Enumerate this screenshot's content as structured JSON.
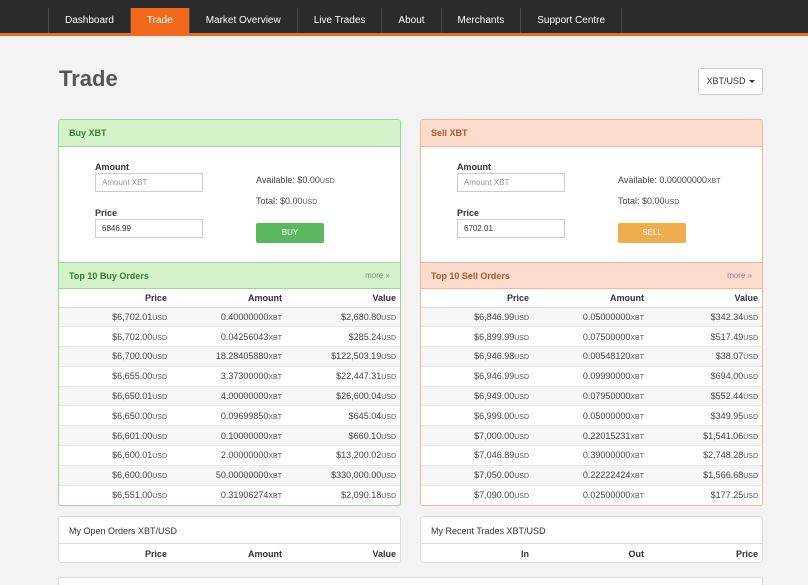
{
  "nav": {
    "items": [
      {
        "label": "Dashboard"
      },
      {
        "label": "Trade"
      },
      {
        "label": "Market Overview"
      },
      {
        "label": "Live Trades"
      },
      {
        "label": "About"
      },
      {
        "label": "Merchants"
      },
      {
        "label": "Support Centre"
      }
    ],
    "active_color": "#f26b1d"
  },
  "page": {
    "title": "Trade",
    "pair": "XBT/USD"
  },
  "buy": {
    "header": "Buy XBT",
    "amount_label": "Amount",
    "amount_placeholder": "Amount XBT",
    "price_label": "Price",
    "price_value": "6846.99",
    "available_label": "Available:",
    "available_value": "$0.00",
    "available_unit": "USD",
    "total_label": "Total:",
    "total_value": "$0.00",
    "total_unit": "USD",
    "button": "BUY",
    "button_color": "#5cb85c"
  },
  "sell": {
    "header": "Sell XBT",
    "amount_label": "Amount",
    "amount_placeholder": "Amount XBT",
    "price_label": "Price",
    "price_value": "6702.01",
    "available_label": "Available:",
    "available_value": "0.00000000",
    "available_unit": "XBT",
    "total_label": "Total:",
    "total_value": "$0.00",
    "total_unit": "USD",
    "button": "SELL",
    "button_color": "#f0ad4e"
  },
  "buy_orders": {
    "title": "Top 10 Buy Orders",
    "more": "more »",
    "columns": [
      "Price",
      "Amount",
      "Value"
    ],
    "rows": [
      [
        "$6,702.01",
        "0.40000000",
        "$2,680.80"
      ],
      [
        "$6,702.00",
        "0.04256043",
        "$285.24"
      ],
      [
        "$6,700.00",
        "18.28405880",
        "$122,503.19"
      ],
      [
        "$6,655.00",
        "3.37300000",
        "$22,447.31"
      ],
      [
        "$6,650.01",
        "4.00000000",
        "$26,600.04"
      ],
      [
        "$6,650.00",
        "0.09699850",
        "$645.04"
      ],
      [
        "$6,601.00",
        "0.10000000",
        "$660.10"
      ],
      [
        "$6,600.01",
        "2.00000000",
        "$13,200.02"
      ],
      [
        "$6,600.00",
        "50.00000000",
        "$330,000.00"
      ],
      [
        "$6,551.00",
        "0.31906274",
        "$2,090.18"
      ]
    ]
  },
  "sell_orders": {
    "title": "Top 10 Sell Orders",
    "more": "more »",
    "columns": [
      "Price",
      "Amount",
      "Value"
    ],
    "rows": [
      [
        "$6,846.99",
        "0.05000000",
        "$342.34"
      ],
      [
        "$6,899.99",
        "0.07500000",
        "$517.49"
      ],
      [
        "$6,946.98",
        "0.00548120",
        "$38.07"
      ],
      [
        "$6,946.99",
        "0.09990000",
        "$694.00"
      ],
      [
        "$6,949.00",
        "0.07950000",
        "$552.44"
      ],
      [
        "$6,999.00",
        "0.05000000",
        "$349.95"
      ],
      [
        "$7,000.00",
        "0.22015231",
        "$1,541.06"
      ],
      [
        "$7,046.89",
        "0.39000000",
        "$2,748.28"
      ],
      [
        "$7,050.00",
        "0.22222424",
        "$1,566.68"
      ],
      [
        "$7,090.00",
        "0.02500000",
        "$177.25"
      ]
    ]
  },
  "units": {
    "usd": "USD",
    "xbt": "XBT"
  },
  "open_orders": {
    "title": "My Open Orders XBT/USD",
    "columns": [
      "Price",
      "Amount",
      "Value"
    ]
  },
  "recent_trades": {
    "title": "My Recent Trades XBT/USD",
    "columns": [
      "In",
      "Out",
      "Price"
    ]
  }
}
